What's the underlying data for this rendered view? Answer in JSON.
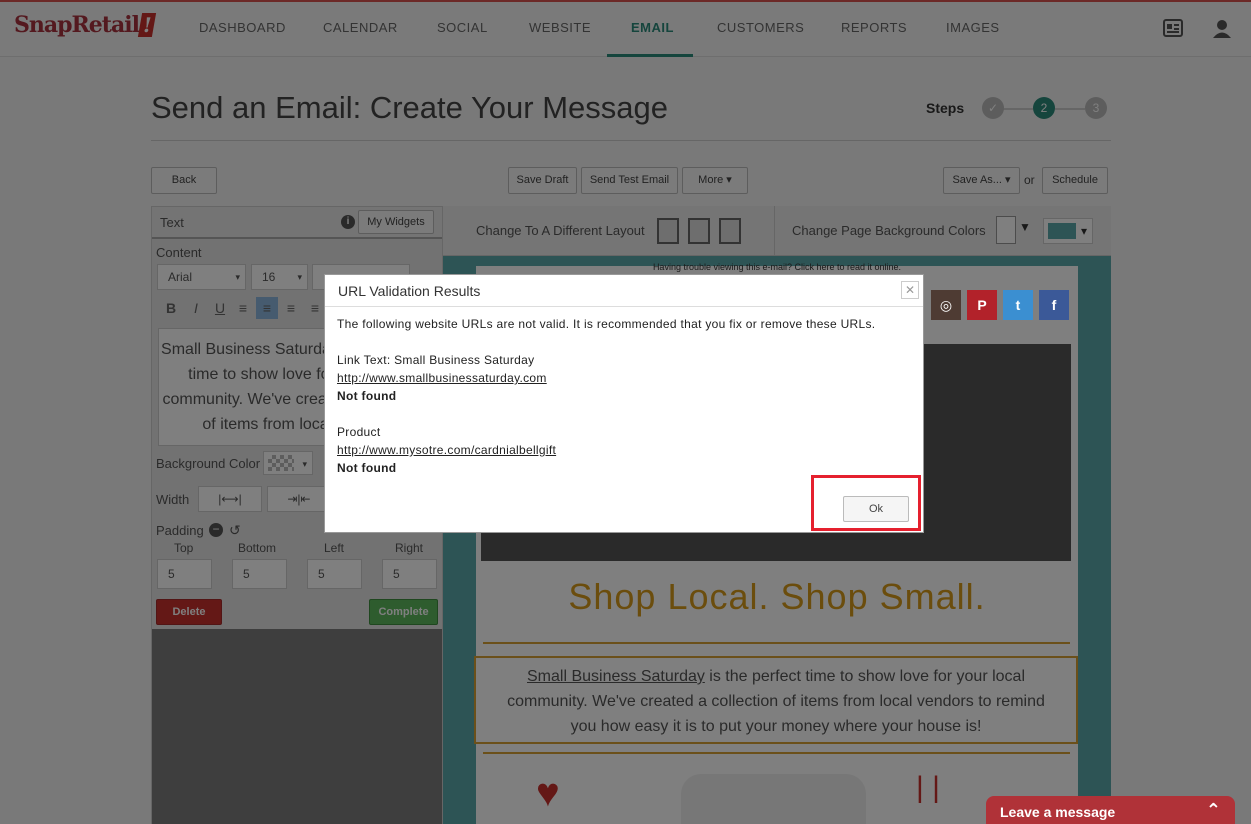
{
  "app": {
    "logo": "SnapRetail",
    "logo_bang": "!"
  },
  "nav": {
    "items": [
      {
        "label": "DASHBOARD"
      },
      {
        "label": "CALENDAR"
      },
      {
        "label": "SOCIAL"
      },
      {
        "label": "WEBSITE"
      },
      {
        "label": "EMAIL"
      },
      {
        "label": "CUSTOMERS"
      },
      {
        "label": "REPORTS"
      },
      {
        "label": "IMAGES"
      }
    ],
    "active": "EMAIL"
  },
  "page": {
    "title": "Send an Email: Create Your Message",
    "steps_label": "Steps",
    "steps": [
      {
        "label": "✓"
      },
      {
        "label": "2"
      },
      {
        "label": "3"
      }
    ]
  },
  "toolbar": {
    "back": "Back",
    "save_draft": "Save Draft",
    "send_test": "Send Test Email",
    "more": "More ▾",
    "save_as": "Save As... ▾",
    "or": "or",
    "schedule": "Schedule"
  },
  "editor": {
    "panel_title": "Text",
    "my_widgets": "My Widgets",
    "content_label": "Content",
    "font": "Arial",
    "size": "16",
    "text_preview": "Small Business Saturday is the perfect time to show love for your local community. We've created a collection of items from local vendors",
    "bg_color_label": "Background Color",
    "width_label": "Width",
    "padding_label": "Padding",
    "padding": {
      "top_label": "Top",
      "bottom_label": "Bottom",
      "left_label": "Left",
      "right_label": "Right",
      "top": "5",
      "bottom": "5",
      "left": "5",
      "right": "5"
    },
    "delete": "Delete",
    "complete": "Complete"
  },
  "layout_bar": {
    "change_layout": "Change To A Different Layout",
    "change_bg": "Change Page Background Colors"
  },
  "email": {
    "trouble_text": "Having trouble viewing this e-mail? Click here to read it online.",
    "headline": "Shop Local. Shop Small.",
    "body_link": "Small Business Saturday",
    "body_text": " is the perfect time to show love for your local community. We've created a collection of items from local vendors to remind you how easy it is to put your money where your house is!",
    "colors": {
      "headline": "#d79a1b",
      "frame": "#d6a035"
    }
  },
  "dialog": {
    "title": "URL Validation Results",
    "intro": "The following website URLs are not valid. It is recommended that you fix or remove these URLs.",
    "items": [
      {
        "label": "Link Text: Small Business Saturday",
        "url": "http://www.smallbusinessaturday.com",
        "status": "Not found"
      },
      {
        "label": "Product",
        "url": "http://www.mysotre.com/cardnialbellgift",
        "status": "Not found"
      }
    ],
    "ok": "Ok",
    "close": "✕"
  },
  "chat": {
    "label": "Leave a message",
    "icon": "⌃"
  }
}
